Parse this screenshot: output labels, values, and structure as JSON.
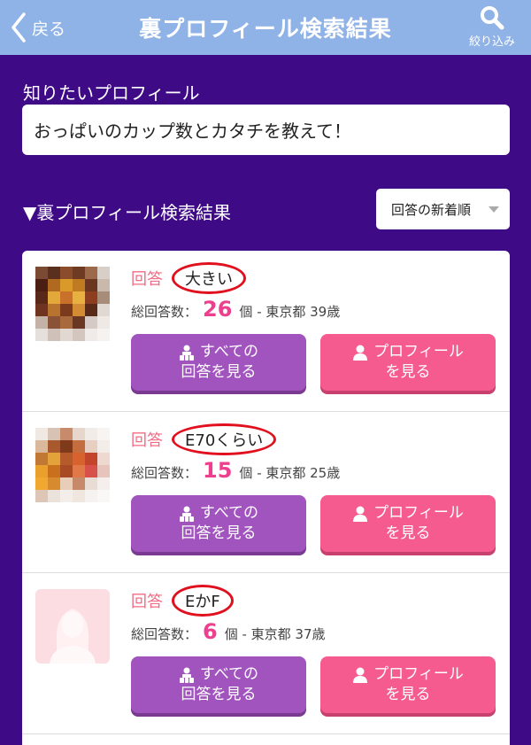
{
  "header": {
    "back_label": "戻る",
    "title": "裏プロフィール検索結果",
    "filter_label": "絞り込み"
  },
  "question": {
    "label": "知りたいプロフィール",
    "text": "おっぱいのカップ数とカタチを教えて！"
  },
  "results_section": {
    "title": "▼裏プロフィール検索結果",
    "sort_selected": "回答の新着順"
  },
  "results": [
    {
      "answer_label": "回答",
      "answer": "大きい",
      "stats_prefix": "総回答数：",
      "count": "26",
      "stats_suffix": "個 - 東京都 39歳",
      "btn_all_line1": "すべての",
      "btn_all_line2": "回答を見る",
      "btn_profile_line1": "プロフィール",
      "btn_profile_line2": "を見る",
      "avatar": "pixelated-photo"
    },
    {
      "answer_label": "回答",
      "answer": "E70くらい",
      "stats_prefix": "総回答数：",
      "count": "15",
      "stats_suffix": "個 - 東京都 25歳",
      "btn_all_line1": "すべての",
      "btn_all_line2": "回答を見る",
      "btn_profile_line1": "プロフィール",
      "btn_profile_line2": "を見る",
      "avatar": "pixelated-photo"
    },
    {
      "answer_label": "回答",
      "answer": "EかF",
      "stats_prefix": "総回答数：",
      "count": "6",
      "stats_suffix": "個 - 東京都 37歳",
      "btn_all_line1": "すべての",
      "btn_all_line2": "回答を見る",
      "btn_profile_line1": "プロフィール",
      "btn_profile_line2": "を見る",
      "avatar": "default-female-silhouette"
    }
  ],
  "colors": {
    "header_bg": "#8fb3e6",
    "page_bg": "#3e0a86",
    "answer_label": "#f26b84",
    "count": "#ee3f8e",
    "btn_all": "#a254be",
    "btn_profile": "#f65b8f",
    "highlight_circle": "#e0101e"
  },
  "icons": {
    "back": "chevron-left-icon",
    "filter": "search-icon",
    "all_answers": "group-icon",
    "profile": "person-icon"
  }
}
